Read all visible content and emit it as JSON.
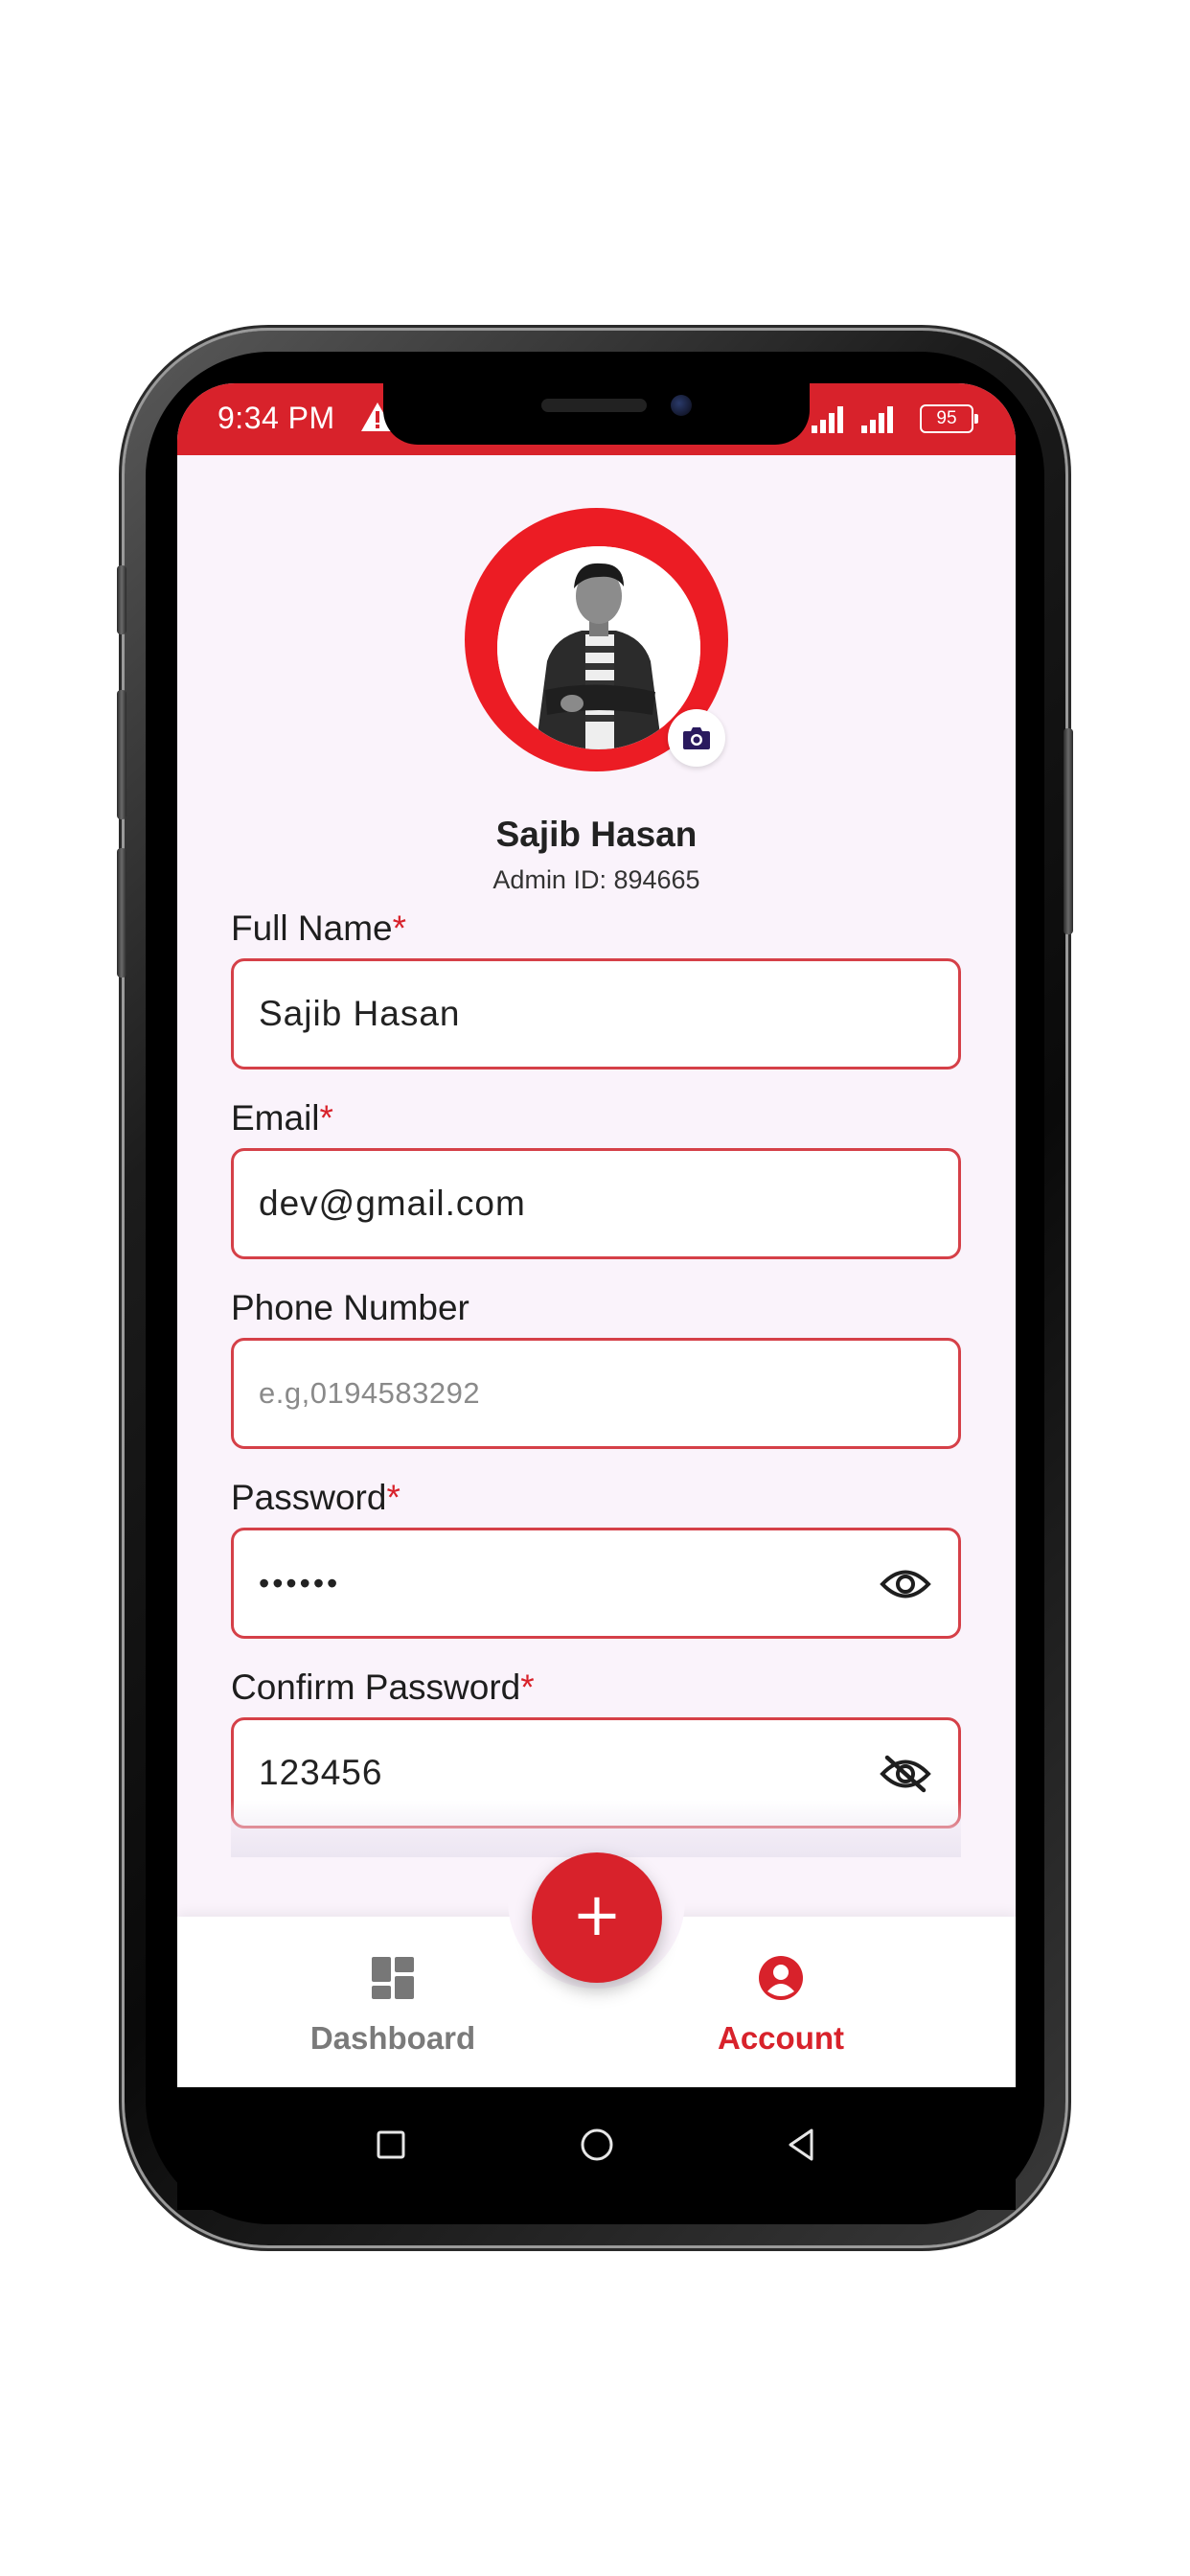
{
  "status_bar": {
    "time": "9:34 PM",
    "battery": "95",
    "color": "#d8222b"
  },
  "profile": {
    "name": "Sajib Hasan",
    "admin_id": "Admin ID: 894665"
  },
  "form": {
    "full_name": {
      "label": "Full Name",
      "required": "*",
      "value": "Sajib Hasan"
    },
    "email": {
      "label": "Email",
      "required": "*",
      "value": "dev@gmail.com"
    },
    "phone": {
      "label": "Phone Number",
      "placeholder": "e.g,0194583292"
    },
    "password": {
      "label": "Password",
      "required": "*",
      "value": "••••••",
      "toggle_icon": "eye-icon"
    },
    "confirm_password": {
      "label": "Confirm Password",
      "required": "*",
      "value": "123456",
      "toggle_icon": "eye-off-icon"
    }
  },
  "fab": {
    "label": "+"
  },
  "bottom_nav": {
    "items": [
      {
        "label": "Dashboard",
        "icon": "dashboard-icon",
        "active": false
      },
      {
        "label": "Account",
        "icon": "account-icon",
        "active": true
      }
    ]
  },
  "colors": {
    "accent": "#d8222b",
    "background": "#faf3fb",
    "field_border": "#d54048",
    "inactive_nav": "#7a7a7a"
  }
}
